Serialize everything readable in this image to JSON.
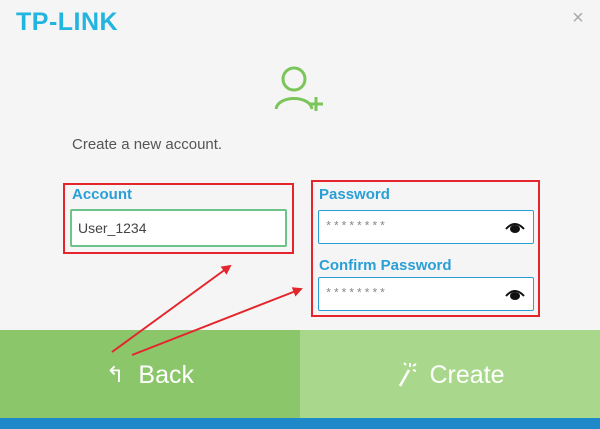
{
  "header": {
    "logo_text": "TP-LINK",
    "close_symbol": "×"
  },
  "intro_text": "Create a new account.",
  "account": {
    "label": "Account",
    "value": "User_1234"
  },
  "password": {
    "label": "Password",
    "value": "********"
  },
  "confirm_password": {
    "label": "Confirm Password",
    "value": "********"
  },
  "buttons": {
    "back_label": "Back",
    "back_icon": "↰",
    "create_label": "Create",
    "create_icon": "wand-icon"
  },
  "colors": {
    "brand": "#22b5e0",
    "label_blue": "#2a9fd6",
    "back_green": "#8cc66b",
    "create_green": "#a9d88c",
    "annotation_red": "#e4252b",
    "bottom_bar": "#1e88c9"
  }
}
